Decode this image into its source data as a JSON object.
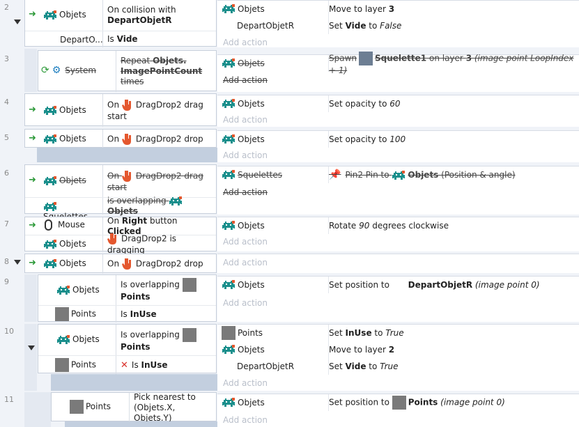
{
  "events": [
    {
      "num": "2",
      "conditions": [
        {
          "object": "Objets",
          "parts": [
            "On collision with",
            "DepartObjetR"
          ]
        },
        {
          "object": "DepartO...",
          "parts": [
            "Is",
            "Vide"
          ]
        }
      ],
      "actions": [
        {
          "object": "Objets",
          "parts": [
            "Move to layer",
            "3"
          ]
        },
        {
          "object": "DepartObjetR",
          "parts": [
            "Set",
            "Vide",
            "to",
            "False"
          ]
        }
      ],
      "add_action": "Add action"
    },
    {
      "num": "3",
      "conditions": [
        {
          "object": "System",
          "parts": [
            "Repeat",
            "Objets.",
            "ImagePointCount",
            "times"
          ]
        }
      ],
      "actions": [
        {
          "object": "Objets",
          "parts": [
            "Spawn",
            "Squelette1",
            "on layer",
            "3",
            "(image point LoopIndex + 1)"
          ]
        }
      ],
      "add_action": "Add action"
    },
    {
      "num": "4",
      "conditions": [
        {
          "object": "Objets",
          "parts": [
            "On",
            "DragDrop2 drag",
            "start"
          ]
        }
      ],
      "actions": [
        {
          "object": "Objets",
          "parts": [
            "Set opacity to",
            "60"
          ]
        }
      ],
      "add_action": "Add action"
    },
    {
      "num": "5",
      "conditions": [
        {
          "object": "Objets",
          "parts": [
            "On",
            "DragDrop2 drop"
          ]
        }
      ],
      "actions": [
        {
          "object": "Objets",
          "parts": [
            "Set opacity to",
            "100"
          ]
        }
      ],
      "add_action": "Add action"
    },
    {
      "num": "6",
      "conditions": [
        {
          "object": "Objets",
          "parts": [
            "On",
            "DragDrop2 drag",
            "start"
          ]
        },
        {
          "object": "Squelettes",
          "parts": [
            "is overlapping",
            "Objets"
          ]
        }
      ],
      "actions": [
        {
          "object": "Squelettes",
          "parts": [
            "Pin2 Pin to",
            "Objets",
            "(Position & angle)"
          ]
        }
      ],
      "add_action": "Add action"
    },
    {
      "num": "7",
      "conditions": [
        {
          "object": "Mouse",
          "parts": [
            "On",
            "Right",
            "button",
            "Clicked"
          ]
        },
        {
          "object": "Objets",
          "parts": [
            "DragDrop2 is dragging"
          ]
        }
      ],
      "actions": [
        {
          "object": "Objets",
          "parts": [
            "Rotate",
            "90",
            "degrees clockwise"
          ]
        }
      ],
      "add_action": "Add action"
    },
    {
      "num": "8",
      "conditions": [
        {
          "object": "Objets",
          "parts": [
            "On",
            "DragDrop2 drop"
          ]
        }
      ],
      "actions": [],
      "add_action": "Add action"
    },
    {
      "num": "9",
      "conditions": [
        {
          "object": "Objets",
          "parts": [
            "Is overlapping",
            "Points"
          ]
        },
        {
          "object": "Points",
          "parts": [
            "Is",
            "InUse"
          ]
        }
      ],
      "actions": [
        {
          "object": "Objets",
          "parts": [
            "Set position to",
            "DepartObjetR",
            "(image point 0)"
          ]
        }
      ],
      "add_action": "Add action"
    },
    {
      "num": "10",
      "conditions": [
        {
          "object": "Objets",
          "parts": [
            "Is overlapping",
            "Points"
          ]
        },
        {
          "object": "Points",
          "parts": [
            "Is",
            "InUse"
          ]
        }
      ],
      "actions": [
        {
          "object": "Points",
          "parts": [
            "Set",
            "InUse",
            "to",
            "True"
          ]
        },
        {
          "object": "Objets",
          "parts": [
            "Move to layer",
            "2"
          ]
        },
        {
          "object": "DepartObjetR",
          "parts": [
            "Set",
            "Vide",
            "to",
            "True"
          ]
        }
      ],
      "add_action": "Add action"
    },
    {
      "num": "11",
      "conditions": [
        {
          "object": "Points",
          "parts": [
            "Pick nearest to",
            "(Objets.X, Objets.Y)"
          ]
        }
      ],
      "actions": [
        {
          "object": "Objets",
          "parts": [
            "Set position to",
            "Points",
            "(image point 0)"
          ]
        }
      ],
      "add_action": "Add action"
    }
  ],
  "colors": {
    "background": "#f0f3f8",
    "band": "#c3cfdf",
    "trigger_arrow": "#2e9a3a",
    "invert_x": "#d9302a",
    "disabled_text": "#444444"
  }
}
